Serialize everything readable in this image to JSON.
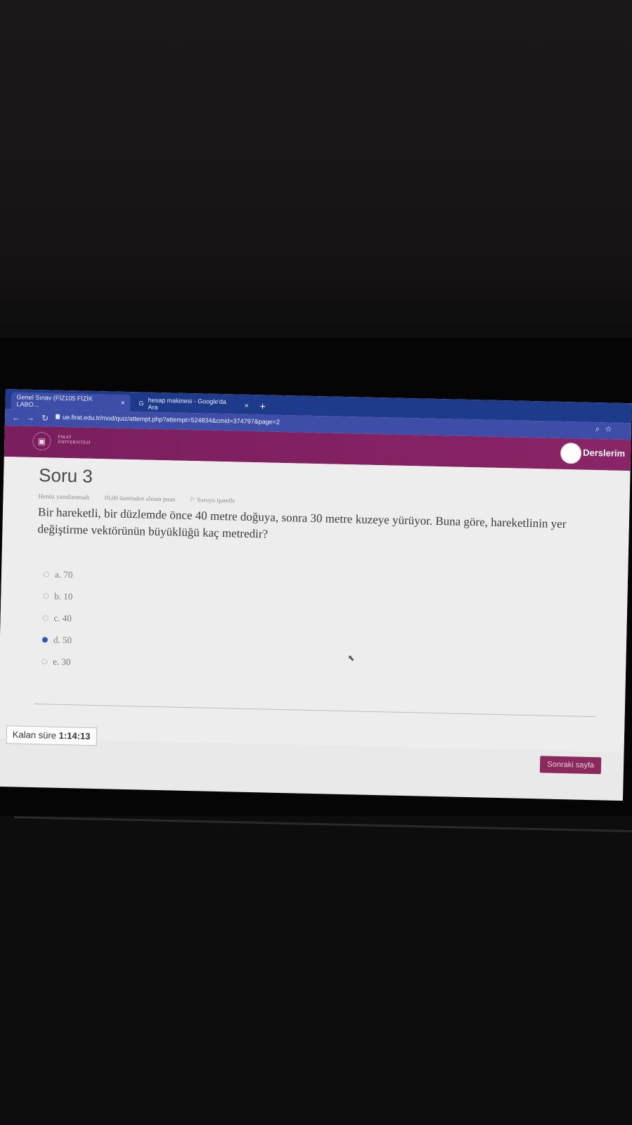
{
  "browser": {
    "tabs": [
      {
        "label": "Genel Sınav (FİZ105 FİZİK LABO...",
        "close": "×"
      },
      {
        "label": "hesap makinesi - Google'da Ara",
        "close": "×"
      }
    ],
    "new_tab": "+",
    "url": "ue.firat.edu.tr/mod/quiz/attempt.php?attempt=524834&cmid=374797&page=2"
  },
  "site": {
    "logo_line1": "FIRAT",
    "logo_line2": "ÜNİVERSİTESİ",
    "nav_label": "Derslerim"
  },
  "question": {
    "title": "Soru 3",
    "status": "Henüz yanıtlanmadı",
    "points": "10,00 üzerinden alınan puan",
    "flag": "Soruyu işaretle",
    "text": "Bir hareketli, bir düzlemde önce 40 metre doğuya, sonra 30 metre kuzeye yürüyor. Buna göre, hareketlinin yer değiştirme vektörünün büyüklüğü kaç metredir?",
    "answers": [
      {
        "label": "a. 70",
        "selected": false
      },
      {
        "label": "b. 10",
        "selected": false
      },
      {
        "label": "c. 40",
        "selected": false
      },
      {
        "label": "d. 50",
        "selected": true
      },
      {
        "label": "e. 30",
        "selected": false
      }
    ]
  },
  "timer": {
    "label": "Kalan süre",
    "value": "1:14:13"
  },
  "next_button": "Sonraki sayfa"
}
